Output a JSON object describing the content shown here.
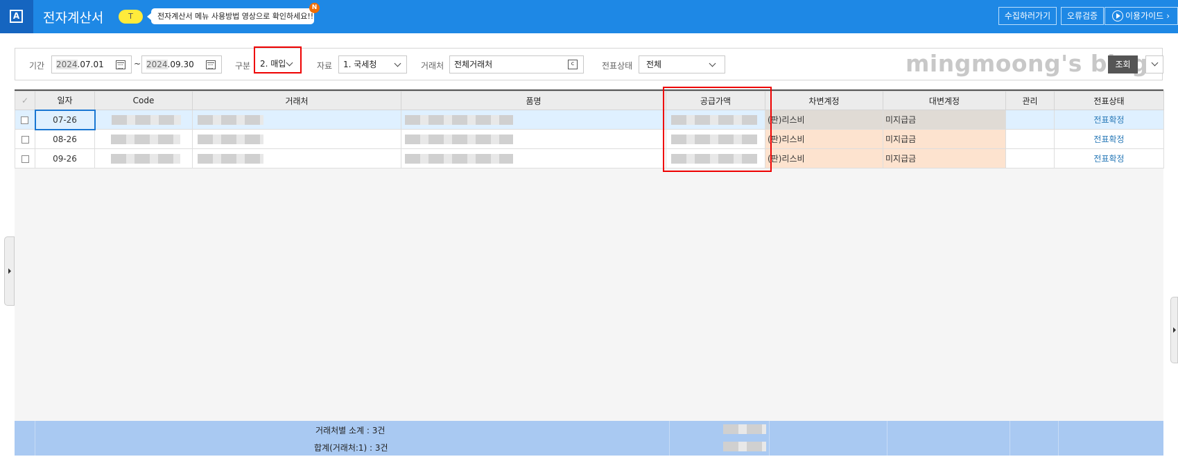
{
  "header": {
    "logo_letter": "A",
    "title": "전자계산서",
    "t_badge": "T",
    "tooltip": "전자계산서 메뉴 사용방법 영상으로 확인하세요!!",
    "new_badge": "N",
    "collect_button": "수집하러가기",
    "error_check_button": "오류검증",
    "guide_button": "이용가이드",
    "guide_chevron": "›"
  },
  "filters": {
    "period_label": "기간",
    "date_from_year": "2024",
    "date_from_rest": ".07.01",
    "tilde": "~",
    "date_to_year": "2024",
    "date_to_rest": ".09.30",
    "type_label": "구분",
    "type_value": "2. 매입",
    "source_label": "자료",
    "source_value": "1. 국세청",
    "partner_label": "거래처",
    "partner_value": "전체거래처",
    "partner_icon_text": "c",
    "status_label": "전표상태",
    "status_value": "전체",
    "watermark": "mingmoong's blog",
    "search_button": "조회"
  },
  "grid": {
    "check_header": "✓",
    "columns": [
      "일자",
      "Code",
      "거래처",
      "품명",
      "공급가액",
      "차변계정",
      "대변계정",
      "관리",
      "전표상태"
    ],
    "rows": [
      {
        "date": "07-26",
        "debit": "(판)리스비",
        "credit": "미지급금",
        "manage": "",
        "status": "전표확정"
      },
      {
        "date": "08-26",
        "debit": "(판)리스비",
        "credit": "미지급금",
        "manage": "",
        "status": "전표확정"
      },
      {
        "date": "09-26",
        "debit": "(판)리스비",
        "credit": "미지급금",
        "manage": "",
        "status": "전표확정"
      }
    ]
  },
  "footer": {
    "subtotal": "거래처별 소계 : 3건",
    "total": "합계(거래처:1) : 3건"
  },
  "colors": {
    "header_bg": "#1e88e5",
    "highlight_red": "#e00000",
    "footer_bg": "#a9c9f2",
    "debit_cell_bg": "#fde3cf",
    "status_link": "#2a7ab8"
  }
}
